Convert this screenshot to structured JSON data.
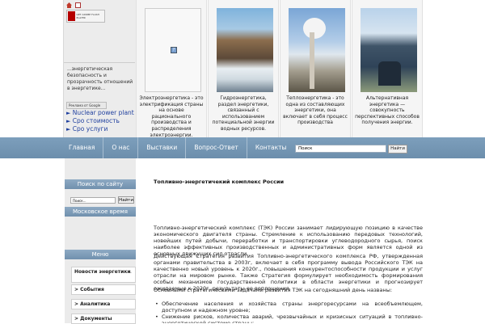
{
  "header": {
    "flash_badge": "GET ADOBE FLASH PLAYER",
    "tagline": "...энергетическая безопасность и прозрачность отношений в энергетике...",
    "google_badge": "Реклама от Google",
    "links": [
      "Nuclear power plant",
      "Сро стоимость",
      "Сро услуги"
    ]
  },
  "energy_cards": [
    {
      "caption": "Электроэнергетика - это электрификация страны на основе рационального производства и распределения электроэнергии."
    },
    {
      "caption": "Гидроэнергетика, раздел энергетики, связанный с использованием потенциальной энергии водных ресурсов."
    },
    {
      "caption": "Теплоэнергетика - это одна из составляющих энергетики, она включает в себя процесс производства"
    },
    {
      "caption": "Альтернативная энергетика — совокупность перспективных способов получения энергии."
    }
  ],
  "nav": {
    "items": [
      "Главная",
      "О нас",
      "Выставки",
      "Вопрос-Ответ",
      "Контакты"
    ],
    "search_placeholder": "Поиск",
    "search_button": "Найти"
  },
  "sidebar": {
    "search_heading": "Поиск по сайту",
    "search_placeholder": "Поиск...",
    "search_button": "Найти",
    "time_heading": "Московское время",
    "menu_heading": "Меню",
    "menu_items": [
      "Новости энергетики",
      "> События",
      "> Аналитика",
      "> Документы"
    ]
  },
  "main": {
    "title": "Топливно-энергетичекий комплекс России",
    "para1": "Топливно-энергетический комплекс (ТЭК) России занимает лидирующую позицию в качестве экономического двигателя страны. Стремление к использованию передовых технологий, новейших путей добычи, переработки и транспортировки углеводородного сырья, поиск наиболее эффективных производственных и административных форм является одной из основных движущих сил отрасли.",
    "para2": "Действующая Стратегия развития Топливно-энергетического комплекса РФ, утвержденная органами правительства в 2003г, включает в себя программу вывода Российского ТЭК на качественно новый уровень к 2020г., повышения конкурентоспособности продукции и услуг отрасли на мировом рынке. Также Стратегия формулирует необходимость формирования особых механизмов государственной политики в области энергетики и прогнозирует ожидаемые к 2020г. результаты ее воплощения.",
    "para3": "Основными стратегическими задачами развития ТЭК на сегодняшний день названы:",
    "bullets": [
      "Обеспечение населения и хозяйства страны энергоресурсами на всеобъемлющем, доступном и надежном уровне;",
      "Снижение рисков, количества аварий, чрезвычайных и кризисных ситуаций в топливно-энергетической системе страны;"
    ]
  }
}
